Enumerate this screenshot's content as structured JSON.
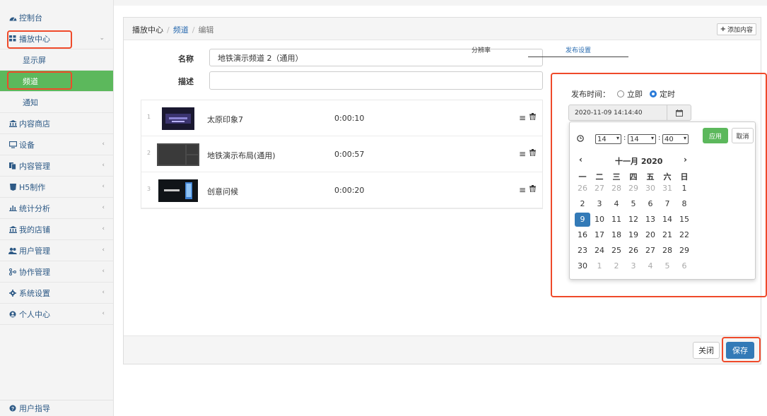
{
  "sidebar": {
    "dashboard": "控制台",
    "play_center": "播放中心",
    "sub_display": "显示屏",
    "sub_channel": "频道",
    "sub_notice": "通知",
    "content_store": "内容商店",
    "device": "设备",
    "content_mgmt": "内容管理",
    "h5": "H5制作",
    "stats": "统计分析",
    "my_store": "我的店铺",
    "user_mgmt": "用户管理",
    "collab_mgmt": "协作管理",
    "sys_settings": "系统设置",
    "personal": "个人中心",
    "user_guide": "用户指导"
  },
  "breadcrumb": {
    "root": "播放中心",
    "section": "频道",
    "current": "编辑"
  },
  "header": {
    "add_content": "添加内容"
  },
  "form": {
    "name_label": "名称",
    "name_value": "地铁演示频道 2（通用）",
    "desc_label": "描述",
    "desc_value": ""
  },
  "items": [
    {
      "index": "1",
      "name": "太原印象7",
      "duration": "0:00:10"
    },
    {
      "index": "2",
      "name": "地铁演示布局(通用)",
      "duration": "0:00:57"
    },
    {
      "index": "3",
      "name": "创意问候",
      "duration": "0:00:20"
    }
  ],
  "tabs": {
    "resolution": "分辨率",
    "publish": "发布设置"
  },
  "publish": {
    "label": "发布时间：",
    "opt_now": "立即",
    "opt_scheduled": "定时",
    "datetime": "2020-11-09 14:14:40"
  },
  "picker": {
    "hour": "14",
    "minute": "14",
    "second": "40",
    "apply": "应用",
    "cancel": "取消",
    "month_title": "十一月 2020",
    "weekdays": [
      "一",
      "二",
      "三",
      "四",
      "五",
      "六",
      "日"
    ],
    "weeks": [
      [
        "26",
        "27",
        "28",
        "29",
        "30",
        "31",
        "1"
      ],
      [
        "2",
        "3",
        "4",
        "5",
        "6",
        "7",
        "8"
      ],
      [
        "9",
        "10",
        "11",
        "12",
        "13",
        "14",
        "15"
      ],
      [
        "16",
        "17",
        "18",
        "19",
        "20",
        "21",
        "22"
      ],
      [
        "23",
        "24",
        "25",
        "26",
        "27",
        "28",
        "29"
      ],
      [
        "30",
        "1",
        "2",
        "3",
        "4",
        "5",
        "6"
      ]
    ],
    "selected_day": "9"
  },
  "footer": {
    "close": "关闭",
    "save": "保存"
  },
  "colors": {
    "accent": "#337ab7",
    "active": "#5cb85c",
    "highlight": "#ef4a2a"
  }
}
